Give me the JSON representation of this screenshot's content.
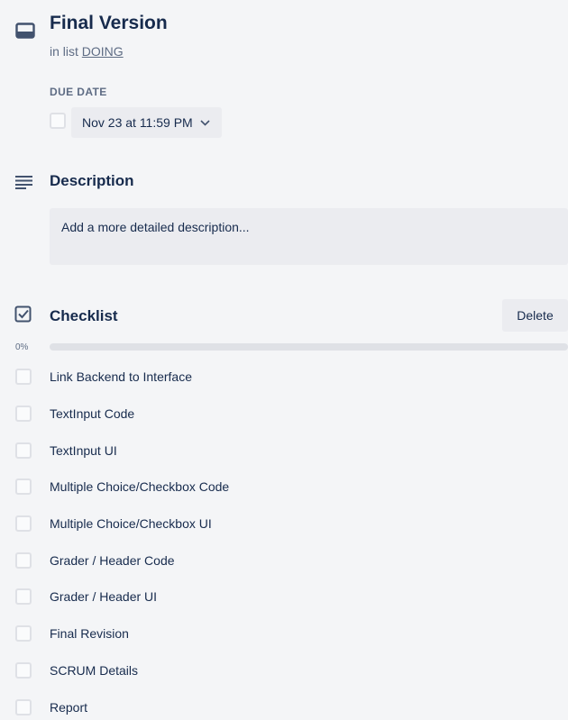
{
  "card": {
    "icon": "card-icon",
    "title": "Final Version",
    "in_list_prefix": "in list",
    "list_name": "DOING"
  },
  "due_date": {
    "label": "DUE DATE",
    "value": "Nov 23 at 11:59 PM",
    "checked": false,
    "icon": "chevron-down-icon"
  },
  "description": {
    "icon": "description-icon",
    "heading": "Description",
    "placeholder": "Add a more detailed description..."
  },
  "checklist": {
    "icon": "checklist-icon",
    "heading": "Checklist",
    "delete_label": "Delete",
    "percent_label": "0%",
    "progress": 0,
    "items": [
      {
        "label": "Link Backend to Interface",
        "checked": false
      },
      {
        "label": "TextInput Code",
        "checked": false
      },
      {
        "label": "TextInput UI",
        "checked": false
      },
      {
        "label": "Multiple Choice/Checkbox Code",
        "checked": false
      },
      {
        "label": "Multiple Choice/Checkbox UI",
        "checked": false
      },
      {
        "label": "Grader / Header Code",
        "checked": false
      },
      {
        "label": "Grader / Header UI",
        "checked": false
      },
      {
        "label": "Final Revision",
        "checked": false
      },
      {
        "label": "SCRUM Details",
        "checked": false
      },
      {
        "label": "Report",
        "checked": false
      }
    ]
  },
  "colors": {
    "text": "#172b4d",
    "muted": "#5e6c84",
    "button_bg": "#ebecf0",
    "page_bg": "#f4f5f7",
    "checkbox_border": "#dfe1e6",
    "progress_fill": "#5aac44"
  }
}
